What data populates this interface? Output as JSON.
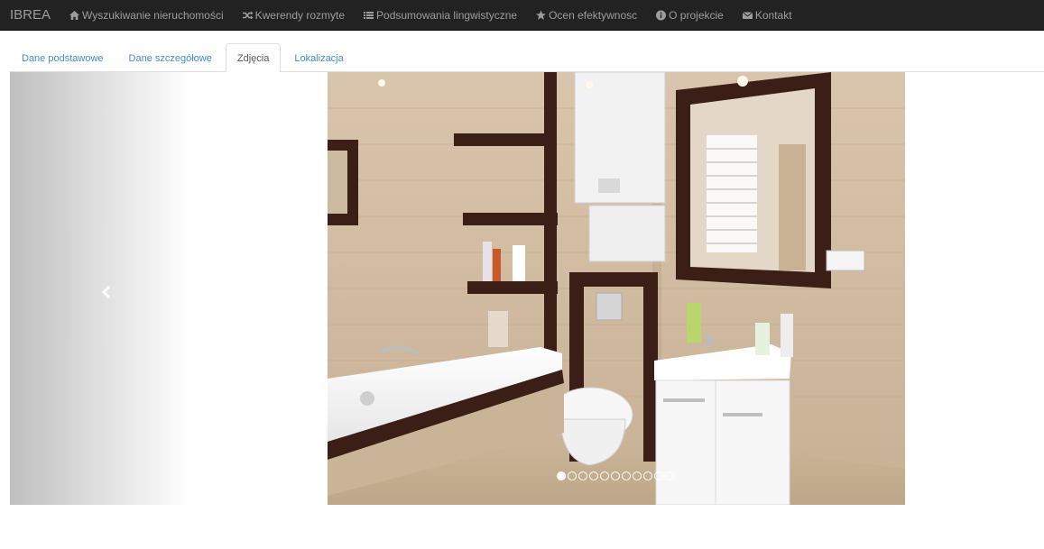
{
  "navbar": {
    "brand": "IBREA",
    "items": [
      {
        "label": "Wyszukiwanie nieruchomości",
        "icon": "home-icon"
      },
      {
        "label": "Kwerendy rozmyte",
        "icon": "shuffle-icon"
      },
      {
        "label": "Podsumowania lingwistyczne",
        "icon": "list-icon"
      },
      {
        "label": "Ocen efektywnosc",
        "icon": "star-icon"
      },
      {
        "label": "O projekcie",
        "icon": "info-icon"
      },
      {
        "label": "Kontakt",
        "icon": "envelope-icon"
      }
    ]
  },
  "tabs": [
    {
      "label": "Dane podstawowe",
      "active": false
    },
    {
      "label": "Dane szczegółowe",
      "active": false
    },
    {
      "label": "Zdjęcia",
      "active": true
    },
    {
      "label": "Lokalizacja",
      "active": false
    }
  ],
  "carousel": {
    "active_index": 0,
    "total_slides": 11,
    "prev_icon": "chevron-left-icon",
    "slide_image": "bathroom-photo"
  }
}
